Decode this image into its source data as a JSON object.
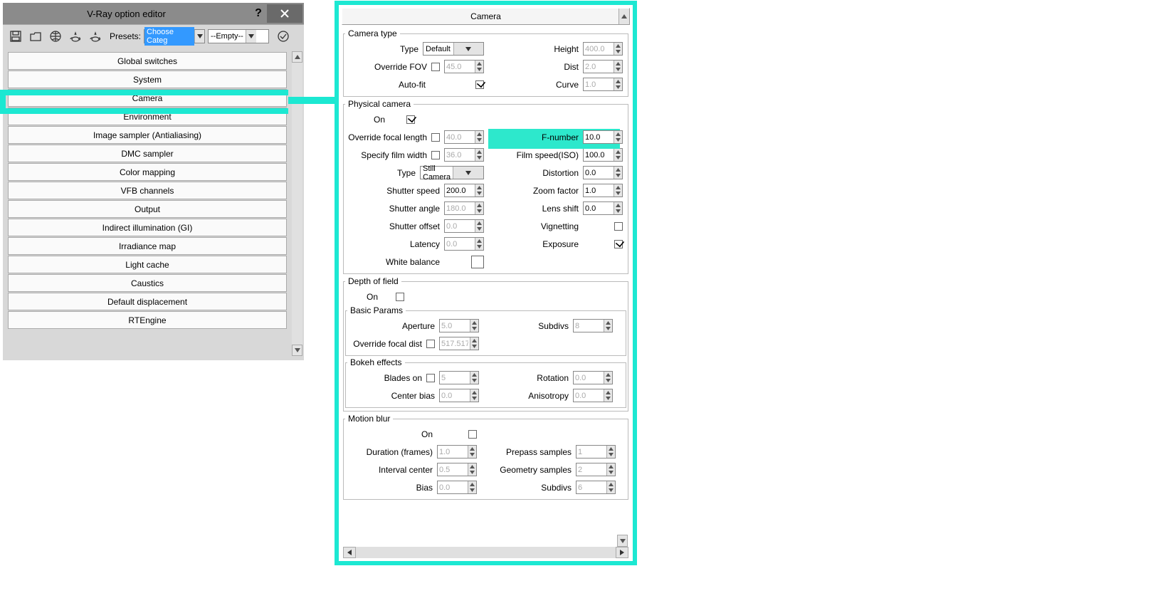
{
  "window": {
    "title": "V-Ray option editor",
    "presets_label": "Presets:",
    "preset_choose": "Choose Categ",
    "preset_empty": "--Empty--"
  },
  "categories": {
    "0": "Global switches",
    "1": "System",
    "2": "Camera",
    "3": "Environment",
    "4": "Image sampler (Antialiasing)",
    "5": "DMC sampler",
    "6": "Color mapping",
    "7": "VFB channels",
    "8": "Output",
    "9": "Indirect illumination (GI)",
    "10": "Irradiance map",
    "11": "Light cache",
    "12": "Caustics",
    "13": "Default displacement",
    "14": "RTEngine"
  },
  "panel": {
    "title": "Camera"
  },
  "cam_type": {
    "legend": "Camera type",
    "type_l": "Type",
    "type_v": "Default",
    "height_l": "Height",
    "height_v": "400.0",
    "ofov_l": "Override FOV",
    "ofov_v": "45.0",
    "dist_l": "Dist",
    "dist_v": "2.0",
    "autofit_l": "Auto-fit",
    "curve_l": "Curve",
    "curve_v": "1.0"
  },
  "phys": {
    "legend": "Physical camera",
    "on_l": "On",
    "ofl_l": "Override focal length",
    "ofl_v": "40.0",
    "fnum_l": "F-number",
    "fnum_v": "10.0",
    "sfw_l": "Specify film width",
    "sfw_v": "36.0",
    "iso_l": "Film speed(ISO)",
    "iso_v": "100.0",
    "type_l": "Type",
    "type_v": "Still Camera",
    "dist_l": "Distortion",
    "dist_v": "0.0",
    "sspd_l": "Shutter speed",
    "sspd_v": "200.0",
    "zoom_l": "Zoom factor",
    "zoom_v": "1.0",
    "sang_l": "Shutter angle",
    "sang_v": "180.0",
    "lshift_l": "Lens shift",
    "lshift_v": "0.0",
    "soff_l": "Shutter offset",
    "soff_v": "0.0",
    "vig_l": "Vignetting",
    "lat_l": "Latency",
    "lat_v": "0.0",
    "exp_l": "Exposure",
    "wb_l": "White balance"
  },
  "dof": {
    "legend": "Depth of field",
    "on_l": "On",
    "basic_legend": "Basic Params",
    "ap_l": "Aperture",
    "ap_v": "5.0",
    "sub_l": "Subdivs",
    "sub_v": "8",
    "ofd_l": "Override focal dist",
    "ofd_v": "517.517",
    "bokeh_legend": "Bokeh effects",
    "blades_l": "Blades on",
    "blades_v": "5",
    "rot_l": "Rotation",
    "rot_v": "0.0",
    "cb_l": "Center bias",
    "cb_v": "0.0",
    "an_l": "Anisotropy",
    "an_v": "0.0"
  },
  "mb": {
    "legend": "Motion blur",
    "on_l": "On",
    "dur_l": "Duration (frames)",
    "dur_v": "1.0",
    "pre_l": "Prepass samples",
    "pre_v": "1",
    "ic_l": "Interval center",
    "ic_v": "0.5",
    "gs_l": "Geometry samples",
    "gs_v": "2",
    "bias_l": "Bias",
    "bias_v": "0.0",
    "sub_l": "Subdivs",
    "sub_v": "6"
  }
}
